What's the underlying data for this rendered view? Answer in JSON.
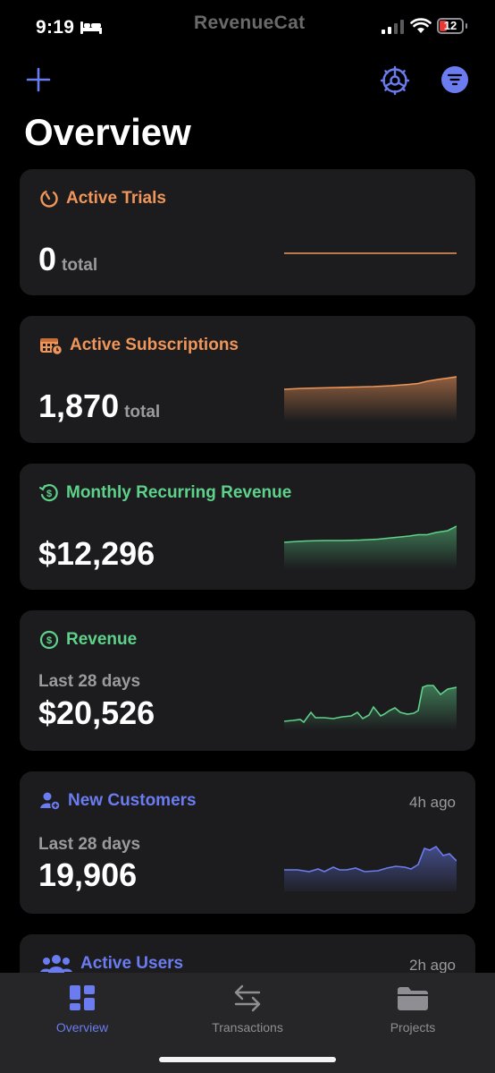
{
  "status": {
    "time": "9:19",
    "app_logo": "RevenueCat",
    "battery": "12"
  },
  "toolbar": {
    "add": "plus-icon",
    "settings": "gear-icon",
    "filter": "filter-icon"
  },
  "page_title": "Overview",
  "cards": [
    {
      "title": "Active Trials",
      "value": "0",
      "unit": "total",
      "color": "#f0965a",
      "icon": "timer-icon"
    },
    {
      "title": "Active Subscriptions",
      "value": "1,870",
      "unit": "total",
      "color": "#f0965a",
      "icon": "calendar-icon"
    },
    {
      "title": "Monthly Recurring Revenue",
      "value": "$12,296",
      "color": "#5ed28a",
      "icon": "recurring-dollar-icon"
    },
    {
      "title": "Revenue",
      "sub": "Last 28 days",
      "value": "$20,526",
      "color": "#5ed28a",
      "icon": "dollar-circle-icon"
    },
    {
      "title": "New Customers",
      "ago": "4h ago",
      "sub": "Last 28 days",
      "value": "19,906",
      "color": "#6a7cf0",
      "icon": "add-user-icon"
    },
    {
      "title": "Active Users",
      "ago": "2h ago",
      "color": "#6a7cf0",
      "icon": "users-icon"
    }
  ],
  "tabs": [
    {
      "label": "Overview",
      "active": true,
      "icon": "dashboard-icon"
    },
    {
      "label": "Transactions",
      "active": false,
      "icon": "arrows-icon"
    },
    {
      "label": "Projects",
      "active": false,
      "icon": "folder-icon"
    }
  ]
}
